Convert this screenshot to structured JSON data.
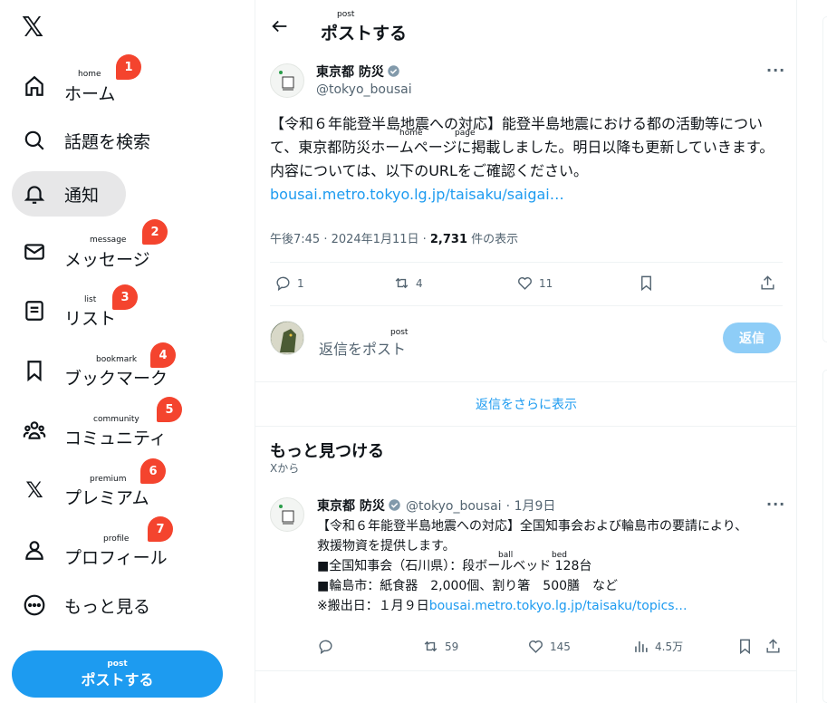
{
  "sidebar": {
    "items": [
      {
        "label": "ホーム",
        "ruby": "home",
        "badge": "1"
      },
      {
        "label": "話題を検索"
      },
      {
        "label": "通知"
      },
      {
        "label": "メッセージ",
        "ruby": "message",
        "badge": "2"
      },
      {
        "label": "リスト",
        "ruby": "list",
        "badge": "3"
      },
      {
        "label": "ブックマーク",
        "ruby": "bookmark",
        "badge": "4"
      },
      {
        "label": "コミュニティ",
        "ruby": "community",
        "badge": "5"
      },
      {
        "label": "プレミアム",
        "ruby": "premium",
        "badge": "6"
      },
      {
        "label": "プロフィール",
        "ruby": "profile",
        "badge": "7"
      },
      {
        "label": "もっと見る"
      }
    ],
    "post_button": {
      "label": "ポストする",
      "ruby": "post"
    }
  },
  "header": {
    "title": "ポストする",
    "ruby": "post"
  },
  "tweet": {
    "name": "東京都 防災",
    "handle": "@tokyo_bousai",
    "text_1": "【令和６年能登半島地震への対応】能登半島地震における都の活動等について、東京都防災ホームページに掲載しました。明日以降も更新していきます。内容については、以下のURLをご確認ください。",
    "ruby_home": "home",
    "ruby_page": "page",
    "link": "bousai.metro.tokyo.lg.jp/taisaku/saigai…",
    "time": "午後7:45 · 2024年1月11日 · ",
    "views": "2,731",
    "views_label": " 件の表示",
    "replies": "1",
    "reposts": "4",
    "likes": "11"
  },
  "reply_box": {
    "placeholder": "返信をポスト",
    "ruby": "post",
    "button": "返信"
  },
  "show_more_replies": "返信をさらに表示",
  "discover": {
    "title": "もっと見つける",
    "subtitle": "Xから"
  },
  "tweet2": {
    "name": "東京都 防災",
    "handle": "@tokyo_bousai",
    "date": "· 1月9日",
    "line1": "【令和６年能登半島地震への対応】全国知事会および輪島市の要請により、",
    "line2": "救援物資を提供します。",
    "line3": "■全国知事会（石川県）：段ボールベッド 128台",
    "ruby_ball": "ball",
    "ruby_bed": "bed",
    "line4": "■輪島市：紙食器　2,000個、割り箸　500膳　など",
    "line5": "※搬出日：１月９日",
    "link": "bousai.metro.tokyo.lg.jp/taisaku/topics…",
    "replies": "",
    "reposts": "59",
    "likes": "145",
    "views": "4.5万"
  },
  "colors": {
    "accent": "#1d9bf0",
    "badge": "#f4442e",
    "muted": "#536471"
  }
}
